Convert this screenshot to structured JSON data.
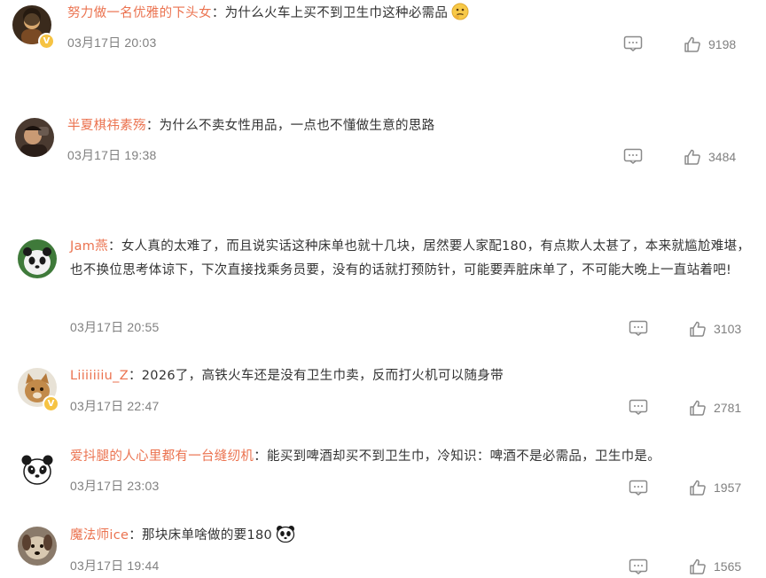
{
  "comments": [
    {
      "username": "努力做一名优雅的下头女",
      "separator": "：",
      "text": "为什么火车上买不到卫生巾这种必需品",
      "time": "03月17日 20:03",
      "likes": "9198",
      "verified": true,
      "avatar_icon": "avatar-dark-portrait",
      "emoji": "thinking-face"
    },
    {
      "username": "半夏棋祎素殇",
      "separator": "：",
      "text": "为什么不卖女性用品，一点也不懂做生意的思路",
      "time": "03月17日 19:38",
      "likes": "3484",
      "verified": false,
      "avatar_icon": "avatar-person-photo"
    },
    {
      "username": "Jam燕",
      "separator": "：",
      "text": "女人真的太难了，而且说实话这种床单也就十几块，居然要人家配180，有点欺人太甚了，本来就尴尬难堪，也不换位思考体谅下，下次直接找乘务员要，没有的话就打预防针，可能要弄脏床单了，不可能大晚上一直站着吧!",
      "time": "03月17日 20:55",
      "likes": "3103",
      "verified": false,
      "avatar_icon": "avatar-panda-photo"
    },
    {
      "username": "Liiiiiiiu_Z",
      "separator": "：",
      "text": "2026了，高铁火车还是没有卫生巾卖，反而打火机可以随身带",
      "time": "03月17日 22:47",
      "likes": "2781",
      "verified": true,
      "avatar_icon": "avatar-cat-photo"
    },
    {
      "username": "爱抖腿的人心里都有一台缝纫机",
      "separator": "：",
      "text": "能买到啤酒却买不到卫生巾，冷知识：啤酒不是必需品，卫生巾是。",
      "time": "03月17日 23:03",
      "likes": "1957",
      "verified": false,
      "avatar_icon": "avatar-panda-cartoon"
    },
    {
      "username": "魔法师ice",
      "separator": "：",
      "text": "那块床单啥做的要180",
      "time": "03月17日 19:44",
      "likes": "1565",
      "verified": false,
      "avatar_icon": "avatar-dog-photo",
      "emoji": "panda-face"
    }
  ],
  "colors": {
    "username": "#eb7350",
    "text": "#333333",
    "meta": "#808080",
    "verified_badge": "#f6c343"
  },
  "icons": {
    "reply": "comment-icon",
    "like": "thumbs-up-icon",
    "verified": "verified-v-icon"
  }
}
